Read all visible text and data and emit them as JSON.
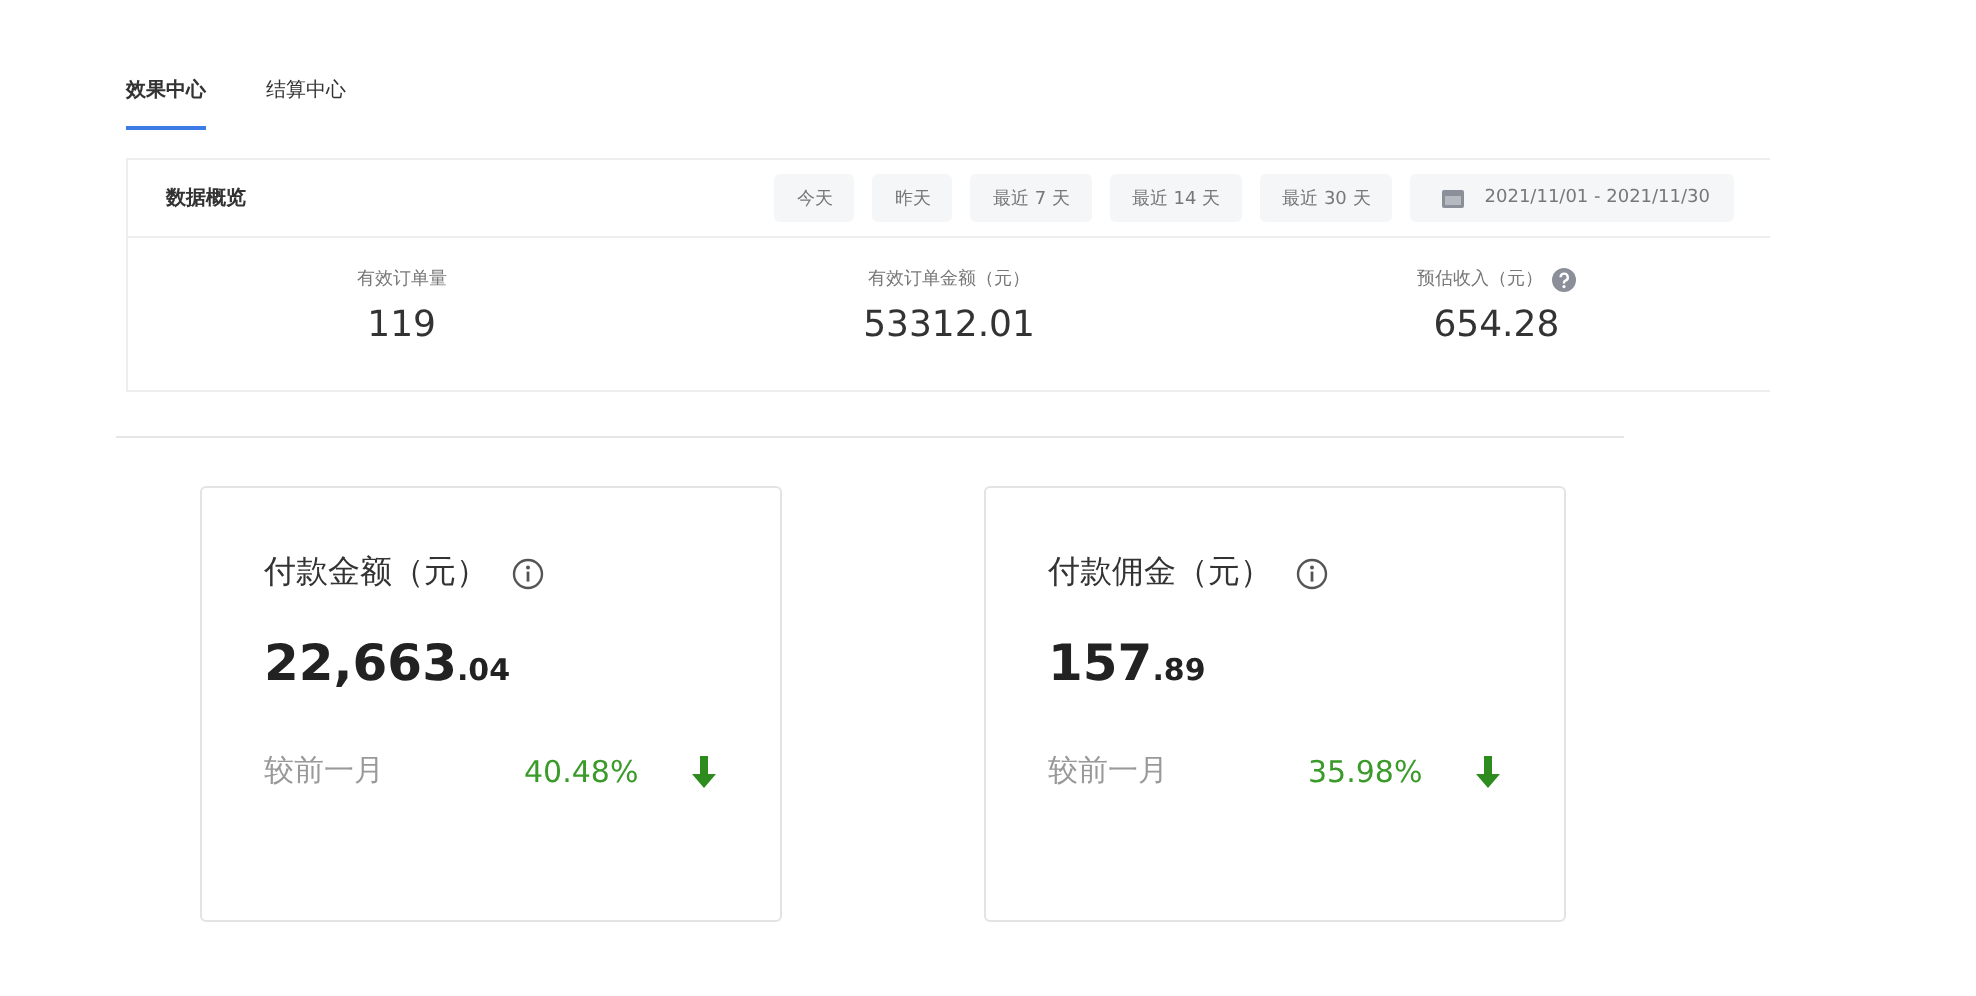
{
  "tabs": [
    {
      "label": "效果中心",
      "selected": true
    },
    {
      "label": "结算中心",
      "selected": false
    }
  ],
  "overview": {
    "title": "数据概览",
    "ranges": [
      {
        "label": "今天"
      },
      {
        "label": "昨天"
      },
      {
        "label": "最近 7 天"
      },
      {
        "label": "最近 14 天"
      },
      {
        "label": "最近 30 天"
      }
    ],
    "date_range": "2021/11/01  -  2021/11/30",
    "stats": [
      {
        "label": "有效订单量",
        "value": "119",
        "help": false
      },
      {
        "label": "有效订单金额（元）",
        "value": "53312.01",
        "help": false
      },
      {
        "label": "预估收入（元）",
        "value": "654.28",
        "help": true
      }
    ]
  },
  "cards": [
    {
      "title": "付款金额（元）",
      "value_integer": "22,663",
      "value_decimal": ".04",
      "compare_label": "较前一月",
      "change": "40.48%",
      "trend_down": true
    },
    {
      "title": "付款佣金（元）",
      "value_integer": "157",
      "value_decimal": ".89",
      "compare_label": "较前一月",
      "change": "35.98%",
      "trend_down": true
    }
  ]
}
